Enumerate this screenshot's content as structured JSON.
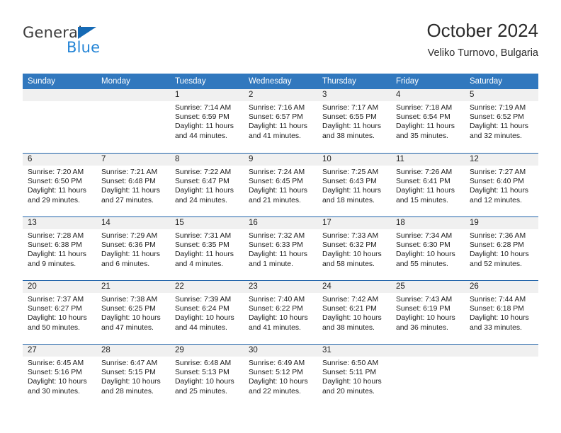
{
  "brand": {
    "name_top": "General",
    "name_bottom": "Blue",
    "triangle_color": "#166ab5",
    "blue_color": "#2384d6"
  },
  "header": {
    "title": "October 2024",
    "subtitle": "Veliko Turnovo, Bulgaria"
  },
  "theme": {
    "header_blue": "#3178be",
    "separator_blue": "#1d61a8",
    "day_band_gray": "#f0f0f0"
  },
  "weekdays": [
    "Sunday",
    "Monday",
    "Tuesday",
    "Wednesday",
    "Thursday",
    "Friday",
    "Saturday"
  ],
  "weeks": [
    [
      {
        "day": "",
        "empty": true
      },
      {
        "day": "",
        "empty": true
      },
      {
        "day": "1",
        "sunrise": "Sunrise: 7:14 AM",
        "sunset": "Sunset: 6:59 PM",
        "daylight": "Daylight: 11 hours and 44 minutes."
      },
      {
        "day": "2",
        "sunrise": "Sunrise: 7:16 AM",
        "sunset": "Sunset: 6:57 PM",
        "daylight": "Daylight: 11 hours and 41 minutes."
      },
      {
        "day": "3",
        "sunrise": "Sunrise: 7:17 AM",
        "sunset": "Sunset: 6:55 PM",
        "daylight": "Daylight: 11 hours and 38 minutes."
      },
      {
        "day": "4",
        "sunrise": "Sunrise: 7:18 AM",
        "sunset": "Sunset: 6:54 PM",
        "daylight": "Daylight: 11 hours and 35 minutes."
      },
      {
        "day": "5",
        "sunrise": "Sunrise: 7:19 AM",
        "sunset": "Sunset: 6:52 PM",
        "daylight": "Daylight: 11 hours and 32 minutes."
      }
    ],
    [
      {
        "day": "6",
        "sunrise": "Sunrise: 7:20 AM",
        "sunset": "Sunset: 6:50 PM",
        "daylight": "Daylight: 11 hours and 29 minutes."
      },
      {
        "day": "7",
        "sunrise": "Sunrise: 7:21 AM",
        "sunset": "Sunset: 6:48 PM",
        "daylight": "Daylight: 11 hours and 27 minutes."
      },
      {
        "day": "8",
        "sunrise": "Sunrise: 7:22 AM",
        "sunset": "Sunset: 6:47 PM",
        "daylight": "Daylight: 11 hours and 24 minutes."
      },
      {
        "day": "9",
        "sunrise": "Sunrise: 7:24 AM",
        "sunset": "Sunset: 6:45 PM",
        "daylight": "Daylight: 11 hours and 21 minutes."
      },
      {
        "day": "10",
        "sunrise": "Sunrise: 7:25 AM",
        "sunset": "Sunset: 6:43 PM",
        "daylight": "Daylight: 11 hours and 18 minutes."
      },
      {
        "day": "11",
        "sunrise": "Sunrise: 7:26 AM",
        "sunset": "Sunset: 6:41 PM",
        "daylight": "Daylight: 11 hours and 15 minutes."
      },
      {
        "day": "12",
        "sunrise": "Sunrise: 7:27 AM",
        "sunset": "Sunset: 6:40 PM",
        "daylight": "Daylight: 11 hours and 12 minutes."
      }
    ],
    [
      {
        "day": "13",
        "sunrise": "Sunrise: 7:28 AM",
        "sunset": "Sunset: 6:38 PM",
        "daylight": "Daylight: 11 hours and 9 minutes."
      },
      {
        "day": "14",
        "sunrise": "Sunrise: 7:29 AM",
        "sunset": "Sunset: 6:36 PM",
        "daylight": "Daylight: 11 hours and 6 minutes."
      },
      {
        "day": "15",
        "sunrise": "Sunrise: 7:31 AM",
        "sunset": "Sunset: 6:35 PM",
        "daylight": "Daylight: 11 hours and 4 minutes."
      },
      {
        "day": "16",
        "sunrise": "Sunrise: 7:32 AM",
        "sunset": "Sunset: 6:33 PM",
        "daylight": "Daylight: 11 hours and 1 minute."
      },
      {
        "day": "17",
        "sunrise": "Sunrise: 7:33 AM",
        "sunset": "Sunset: 6:32 PM",
        "daylight": "Daylight: 10 hours and 58 minutes."
      },
      {
        "day": "18",
        "sunrise": "Sunrise: 7:34 AM",
        "sunset": "Sunset: 6:30 PM",
        "daylight": "Daylight: 10 hours and 55 minutes."
      },
      {
        "day": "19",
        "sunrise": "Sunrise: 7:36 AM",
        "sunset": "Sunset: 6:28 PM",
        "daylight": "Daylight: 10 hours and 52 minutes."
      }
    ],
    [
      {
        "day": "20",
        "sunrise": "Sunrise: 7:37 AM",
        "sunset": "Sunset: 6:27 PM",
        "daylight": "Daylight: 10 hours and 50 minutes."
      },
      {
        "day": "21",
        "sunrise": "Sunrise: 7:38 AM",
        "sunset": "Sunset: 6:25 PM",
        "daylight": "Daylight: 10 hours and 47 minutes."
      },
      {
        "day": "22",
        "sunrise": "Sunrise: 7:39 AM",
        "sunset": "Sunset: 6:24 PM",
        "daylight": "Daylight: 10 hours and 44 minutes."
      },
      {
        "day": "23",
        "sunrise": "Sunrise: 7:40 AM",
        "sunset": "Sunset: 6:22 PM",
        "daylight": "Daylight: 10 hours and 41 minutes."
      },
      {
        "day": "24",
        "sunrise": "Sunrise: 7:42 AM",
        "sunset": "Sunset: 6:21 PM",
        "daylight": "Daylight: 10 hours and 38 minutes."
      },
      {
        "day": "25",
        "sunrise": "Sunrise: 7:43 AM",
        "sunset": "Sunset: 6:19 PM",
        "daylight": "Daylight: 10 hours and 36 minutes."
      },
      {
        "day": "26",
        "sunrise": "Sunrise: 7:44 AM",
        "sunset": "Sunset: 6:18 PM",
        "daylight": "Daylight: 10 hours and 33 minutes."
      }
    ],
    [
      {
        "day": "27",
        "sunrise": "Sunrise: 6:45 AM",
        "sunset": "Sunset: 5:16 PM",
        "daylight": "Daylight: 10 hours and 30 minutes."
      },
      {
        "day": "28",
        "sunrise": "Sunrise: 6:47 AM",
        "sunset": "Sunset: 5:15 PM",
        "daylight": "Daylight: 10 hours and 28 minutes."
      },
      {
        "day": "29",
        "sunrise": "Sunrise: 6:48 AM",
        "sunset": "Sunset: 5:13 PM",
        "daylight": "Daylight: 10 hours and 25 minutes."
      },
      {
        "day": "30",
        "sunrise": "Sunrise: 6:49 AM",
        "sunset": "Sunset: 5:12 PM",
        "daylight": "Daylight: 10 hours and 22 minutes."
      },
      {
        "day": "31",
        "sunrise": "Sunrise: 6:50 AM",
        "sunset": "Sunset: 5:11 PM",
        "daylight": "Daylight: 10 hours and 20 minutes."
      },
      {
        "day": "",
        "empty": true
      },
      {
        "day": "",
        "empty": true
      }
    ]
  ]
}
